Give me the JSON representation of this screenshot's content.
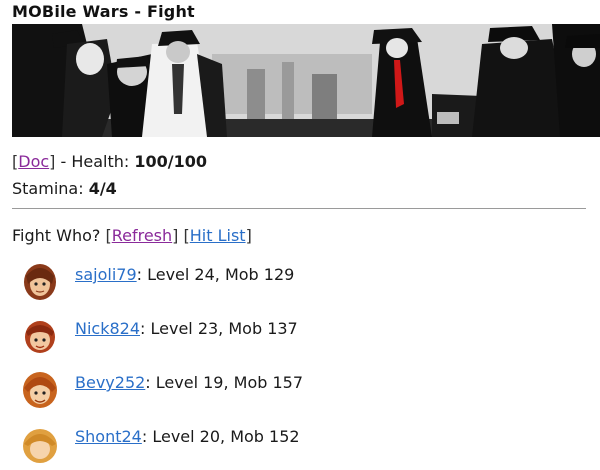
{
  "app": {
    "title": "MOBile Wars - Fight"
  },
  "status": {
    "class_name": "Doc",
    "health_label": "Health:",
    "health_value": "100/100",
    "stamina_label": "Stamina:",
    "stamina_value": "4/4"
  },
  "fight": {
    "prompt": "Fight Who?",
    "refresh_label": "Refresh",
    "hitlist_label": "Hit List"
  },
  "opponents": [
    {
      "name": "sajoli79",
      "details": "Level 24, Mob 129"
    },
    {
      "name": "Nick824",
      "details": "Level 23, Mob 137"
    },
    {
      "name": "Bevy252",
      "details": "Level 19, Mob 157"
    },
    {
      "name": "Shont24",
      "details": "Level 20, Mob 152"
    }
  ],
  "colors": {
    "link": "#2a6fc8",
    "visited_link": "#8a2a9a",
    "accent_tie": "#d01818"
  }
}
